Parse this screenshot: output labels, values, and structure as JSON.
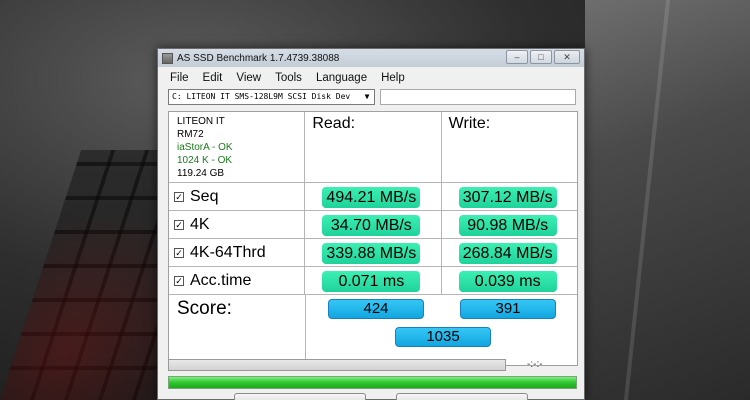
{
  "window": {
    "title": "AS SSD Benchmark 1.7.4739.38088"
  },
  "menu": [
    "File",
    "Edit",
    "View",
    "Tools",
    "Language",
    "Help"
  ],
  "drive": {
    "selected": "C: LITEON IT SMS-128L9M SCSI Disk Dev"
  },
  "disk_info": {
    "vendor": "LITEON IT",
    "model": "RM72",
    "driver_status": "iaStorA - OK",
    "alignment_status": "1024 K - OK",
    "capacity": "119.24 GB"
  },
  "headers": {
    "read": "Read:",
    "write": "Write:"
  },
  "tests": [
    {
      "label": "Seq",
      "read": "494.21 MB/s",
      "write": "307.12 MB/s"
    },
    {
      "label": "4K",
      "read": "34.70 MB/s",
      "write": "90.98 MB/s"
    },
    {
      "label": "4K-64Thrd",
      "read": "339.88 MB/s",
      "write": "268.84 MB/s"
    },
    {
      "label": "Acc.time",
      "read": "0.071 ms",
      "write": "0.039 ms"
    }
  ],
  "score": {
    "label": "Score:",
    "read": "424",
    "write": "391",
    "total": "1035"
  },
  "progress": {
    "timer": "-:-:-",
    "overall_fraction": 1.0
  },
  "colors": {
    "value_fill": "#2ee0a6",
    "score_fill": "#1fb6ec",
    "progress_fill": "#2fc52f"
  }
}
